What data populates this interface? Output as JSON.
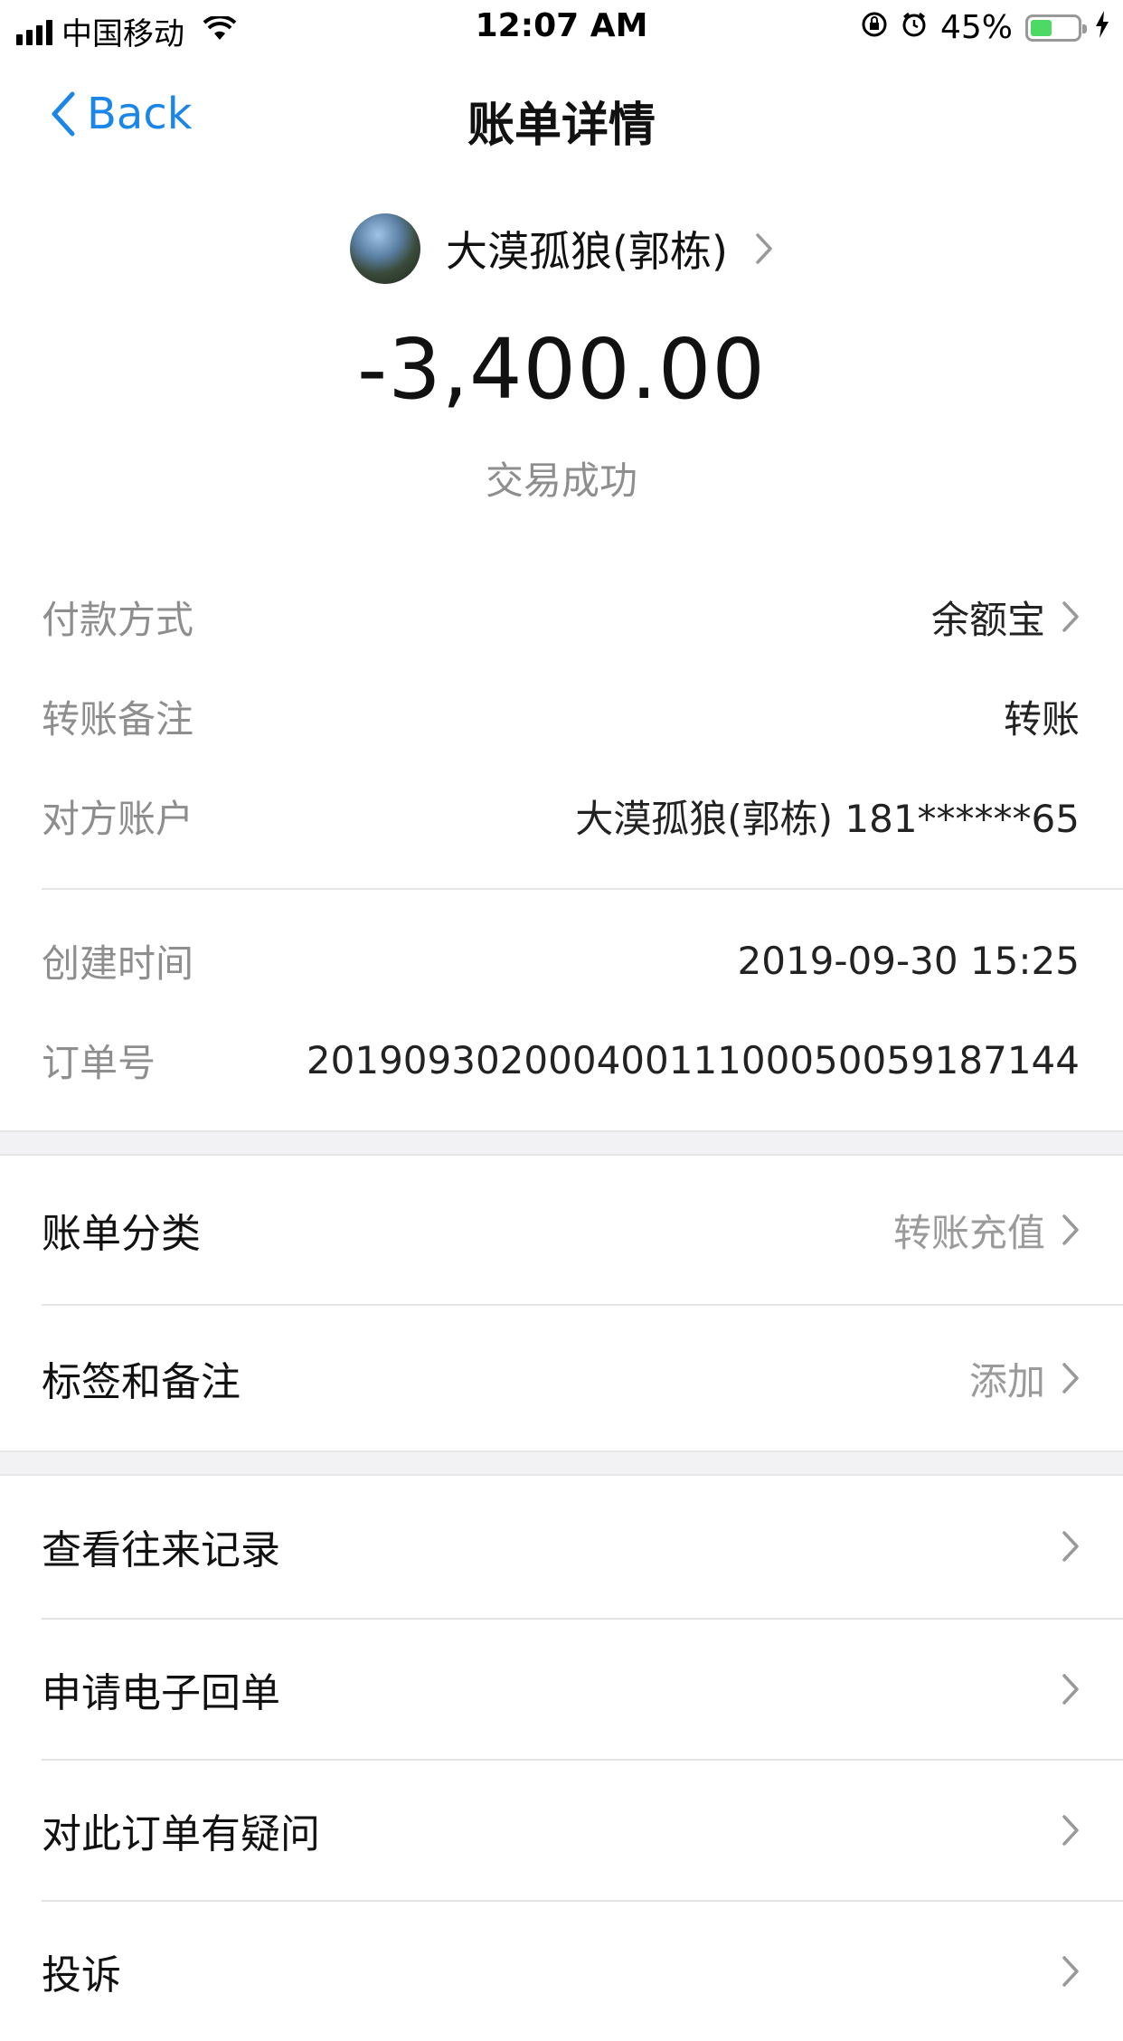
{
  "status_bar": {
    "carrier": "中国移动",
    "time": "12:07 AM",
    "battery_percent": "45%",
    "battery_level": 0.45
  },
  "nav": {
    "back_label": "Back",
    "title": "账单详情"
  },
  "header": {
    "payee_name": "大漠孤狼(郭栋)",
    "amount": "-3,400.00",
    "status": "交易成功"
  },
  "details": [
    {
      "label": "付款方式",
      "value": "余额宝"
    },
    {
      "label": "转账备注",
      "value": "转账"
    },
    {
      "label": "对方账户",
      "value": "大漠孤狼(郭栋) 181******65"
    },
    {
      "label": "创建时间",
      "value": "2019-09-30 15:25"
    },
    {
      "label": "订单号",
      "value": "20190930200040011100050059187144"
    }
  ],
  "options": [
    {
      "label": "账单分类",
      "value": "转账充值"
    },
    {
      "label": "标签和备注",
      "value": "添加"
    }
  ],
  "actions": [
    {
      "label": "查看往来记录"
    },
    {
      "label": "申请电子回单"
    },
    {
      "label": "对此订单有疑问"
    },
    {
      "label": "投诉"
    }
  ],
  "colors": {
    "accent": "#1a86e8",
    "label_gray": "#8e8e8e",
    "battery_green": "#4cd964"
  }
}
